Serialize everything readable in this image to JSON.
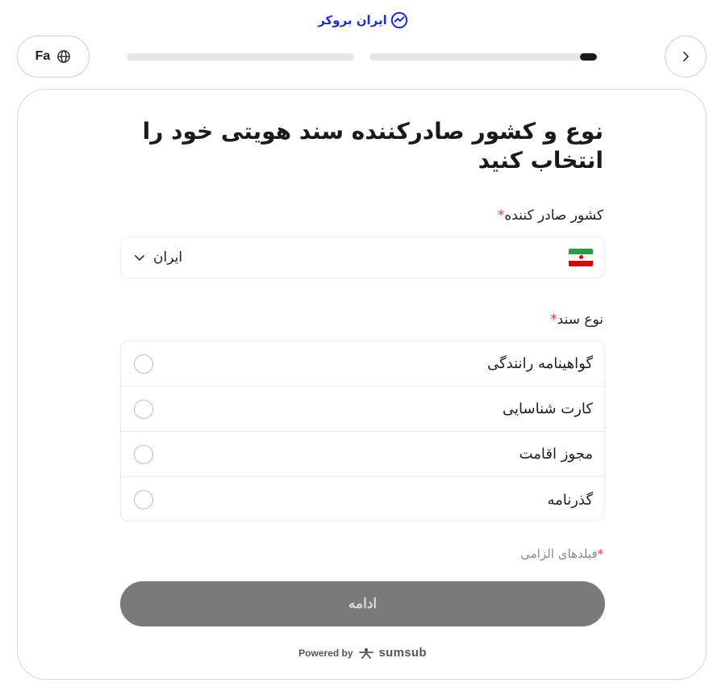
{
  "brand": {
    "name": "ایران بروکر",
    "accent": "#1d2fd6"
  },
  "header": {
    "language_label": "Fa",
    "progress": [
      {
        "filled": 0
      },
      {
        "filled": 0.07
      }
    ]
  },
  "form": {
    "title": "نوع و کشور صادرکننده سند هویتی خود را انتخاب کنید",
    "country": {
      "label": "کشور صادر کننده",
      "required_mark": "*",
      "value": "ایران",
      "flag_icon": "iran-flag-icon"
    },
    "document_type": {
      "label": "نوع سند",
      "required_mark": "*",
      "options": [
        {
          "label": "گواهینامه رانندگی"
        },
        {
          "label": "کارت شناسایی"
        },
        {
          "label": "مجوز اقامت"
        },
        {
          "label": "گذرنامه"
        }
      ]
    },
    "required_note": "فیلدهای الزامی",
    "required_note_mark": "*",
    "continue_label": "ادامه"
  },
  "footer": {
    "powered_by": "Powered by",
    "provider": "sumsub"
  },
  "colors": {
    "required": "#e0364e",
    "button_disabled": "#7a7a7a",
    "progress_fill": "#1a1a1a",
    "progress_track": "#e6e6e6"
  }
}
